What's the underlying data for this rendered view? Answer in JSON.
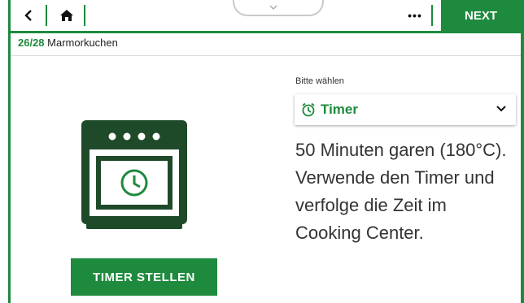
{
  "topbar": {
    "back_icon": "chevron-left-icon",
    "home_icon": "home-icon",
    "handle_icon": "chevron-down-icon",
    "more_label": "•••",
    "next_label": "NEXT"
  },
  "breadcrumb": {
    "step": "26/28",
    "recipe": "Marmorkuchen"
  },
  "left": {
    "oven_icon": "oven-timer-icon",
    "timer_button": "TIMER STELLEN"
  },
  "right": {
    "select_label": "Bitte wählen",
    "select_value": "Timer",
    "select_icon": "alarm-clock-icon",
    "description": "50 Minuten garen (180°C). Verwende den Timer und verfolge die Zeit im Cooking Center."
  },
  "colors": {
    "accent": "#1e8a3e",
    "oven": "#1f4a2a"
  }
}
